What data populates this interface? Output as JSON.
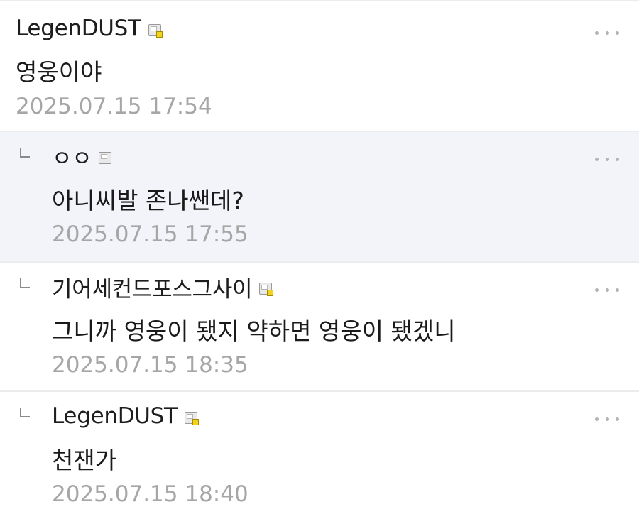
{
  "comments": [
    {
      "author": "LegenDUST",
      "text": "영웅이야",
      "timestamp": "2025.07.15 17:54",
      "is_reply": false
    },
    {
      "author": "ㅇㅇ",
      "text": "아니씨발 존나쌘데?",
      "timestamp": "2025.07.15 17:55",
      "is_reply": true
    },
    {
      "author": "기어세컨드포스그사이",
      "text": "그니까 영웅이 됐지 약하면 영웅이 됐겠니",
      "timestamp": "2025.07.15 18:35",
      "is_reply": true
    },
    {
      "author": "LegenDUST",
      "text": "천잰가",
      "timestamp": "2025.07.15 18:40",
      "is_reply": true
    }
  ],
  "icons": {
    "level_icon": "member-level-icon",
    "more": "more-options-icon",
    "reply": "reply-arrow-icon"
  },
  "colors": {
    "highlight_background": "#f3f4fa",
    "timestamp": "#a6a6a6",
    "divider": "#ececec"
  }
}
